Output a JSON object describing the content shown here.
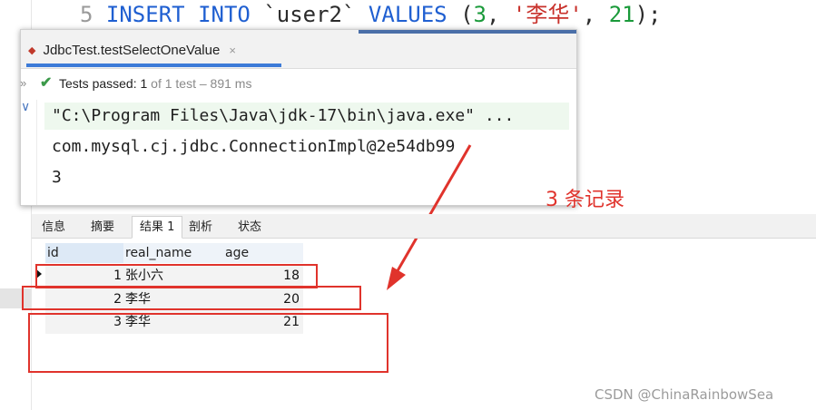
{
  "editor": {
    "line_number": "5",
    "code": {
      "kw1": "INSERT",
      "kw2": "INTO",
      "table": "`user2`",
      "kw3": "VALUES",
      "open": "(",
      "num1": "3",
      "comma1": ",",
      "str": "'李华'",
      "comma2": ",",
      "num2": "21",
      "close": ");"
    }
  },
  "run_popup": {
    "tab_label": "JdbcTest.testSelectOneValue",
    "tab_close": "×",
    "status_passed": "Tests passed: 1",
    "status_detail": "of 1 test – 891 ms",
    "console_lines": [
      "\"C:\\Program Files\\Java\\jdk-17\\bin\\java.exe\" ...",
      "com.mysql.cj.jdbc.ConnectionImpl@2e54db99",
      "3"
    ]
  },
  "annotation": {
    "text": "3 条记录",
    "color": "#e0332c"
  },
  "db_panel": {
    "tabs": [
      "信息",
      "摘要",
      "结果 1",
      "剖析",
      "状态"
    ],
    "active_tab_index": 2,
    "columns": [
      "id",
      "real_name",
      "age"
    ],
    "rows": [
      [
        "1",
        "张小六",
        "18"
      ],
      [
        "2",
        "李华",
        "20"
      ],
      [
        "3",
        "李华",
        "21"
      ]
    ]
  },
  "watermark": "CSDN @ChinaRainbowSea",
  "colors": {
    "keyword": "#1f5fd1",
    "number": "#1a9a3a",
    "string": "#c8312b",
    "pass_check": "#3c9a4a",
    "tab_underline": "#3d7bd8"
  }
}
